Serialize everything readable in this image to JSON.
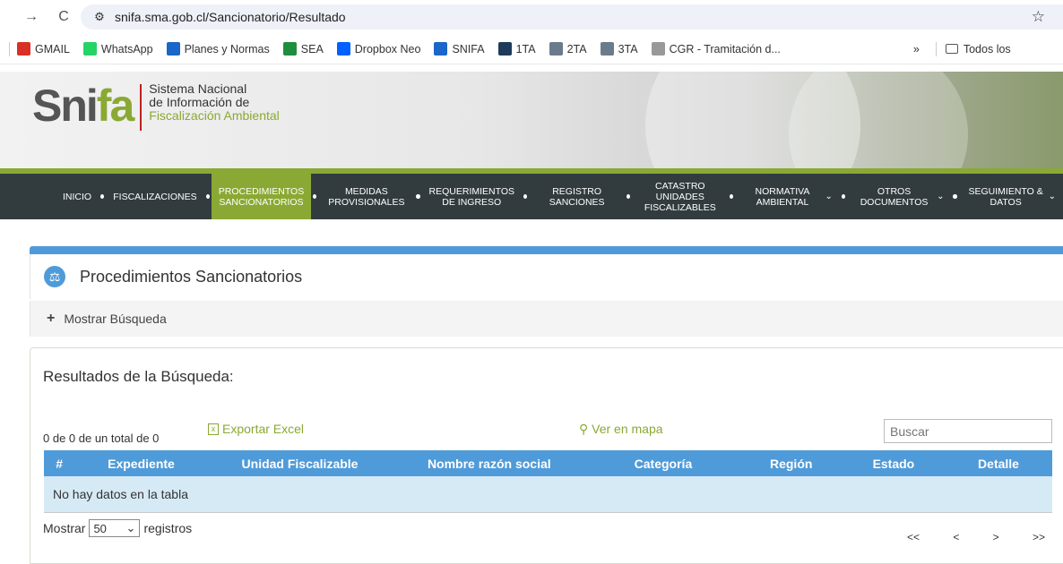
{
  "browser": {
    "url": "snifa.sma.gob.cl/Sancionatorio/Resultado",
    "bookmarks": [
      {
        "label": "GMAIL",
        "color": "#d93025"
      },
      {
        "label": "WhatsApp",
        "color": "#25d366"
      },
      {
        "label": "Planes y Normas",
        "color": "#1a66c9"
      },
      {
        "label": "SEA",
        "color": "#1e8e3e"
      },
      {
        "label": "Dropbox Neo",
        "color": "#0061fe"
      },
      {
        "label": "SNIFA",
        "color": "#1a66c9"
      },
      {
        "label": "1TA",
        "color": "#1f3b5c"
      },
      {
        "label": "2TA",
        "color": "#6a7b8c"
      },
      {
        "label": "3TA",
        "color": "#6a7b8c"
      },
      {
        "label": "CGR - Tramitación d...",
        "color": "#999999"
      }
    ],
    "overflow": "»",
    "all_bookmarks": "Todos los"
  },
  "site": {
    "logo_word_a": "Sni",
    "logo_word_b": "fa",
    "logo_line1": "Sistema Nacional",
    "logo_line2": "de Información de",
    "logo_line3": "Fiscalización Ambiental"
  },
  "menu": [
    {
      "label": "INICIO"
    },
    {
      "label": "FISCALIZACIONES"
    },
    {
      "label": "PROCEDIMIENTOS SANCIONATORIOS"
    },
    {
      "label": "MEDIDAS PROVISIONALES"
    },
    {
      "label": "REQUERIMIENTOS DE INGRESO"
    },
    {
      "label": "REGISTRO SANCIONES"
    },
    {
      "label": "CATASTRO UNIDADES FISCALIZABLES"
    },
    {
      "label": "NORMATIVA AMBIENTAL"
    },
    {
      "label": "OTROS DOCUMENTOS"
    },
    {
      "label": "SEGUIMIENTO & DATOS"
    }
  ],
  "panel": {
    "title": "Procedimientos Sancionatorios",
    "toggle": "Mostrar Búsqueda"
  },
  "results": {
    "heading": "Resultados de la Búsqueda:",
    "count": "0 de 0 de un total de 0",
    "export": "Exportar Excel",
    "map": "Ver en mapa",
    "search_placeholder": "Buscar",
    "columns": [
      "#",
      "Expediente",
      "Unidad Fiscalizable",
      "Nombre razón social",
      "Categoría",
      "Región",
      "Estado",
      "Detalle"
    ],
    "empty": "No hay datos en la tabla",
    "show_label": "Mostrar",
    "page_size": "50",
    "records_label": "registros",
    "pager": [
      "<<",
      "<",
      ">",
      ">>"
    ]
  },
  "colors": {
    "accent_green": "#8aa934",
    "accent_blue": "#4f9bd9",
    "menu_bg": "#323c3f"
  }
}
